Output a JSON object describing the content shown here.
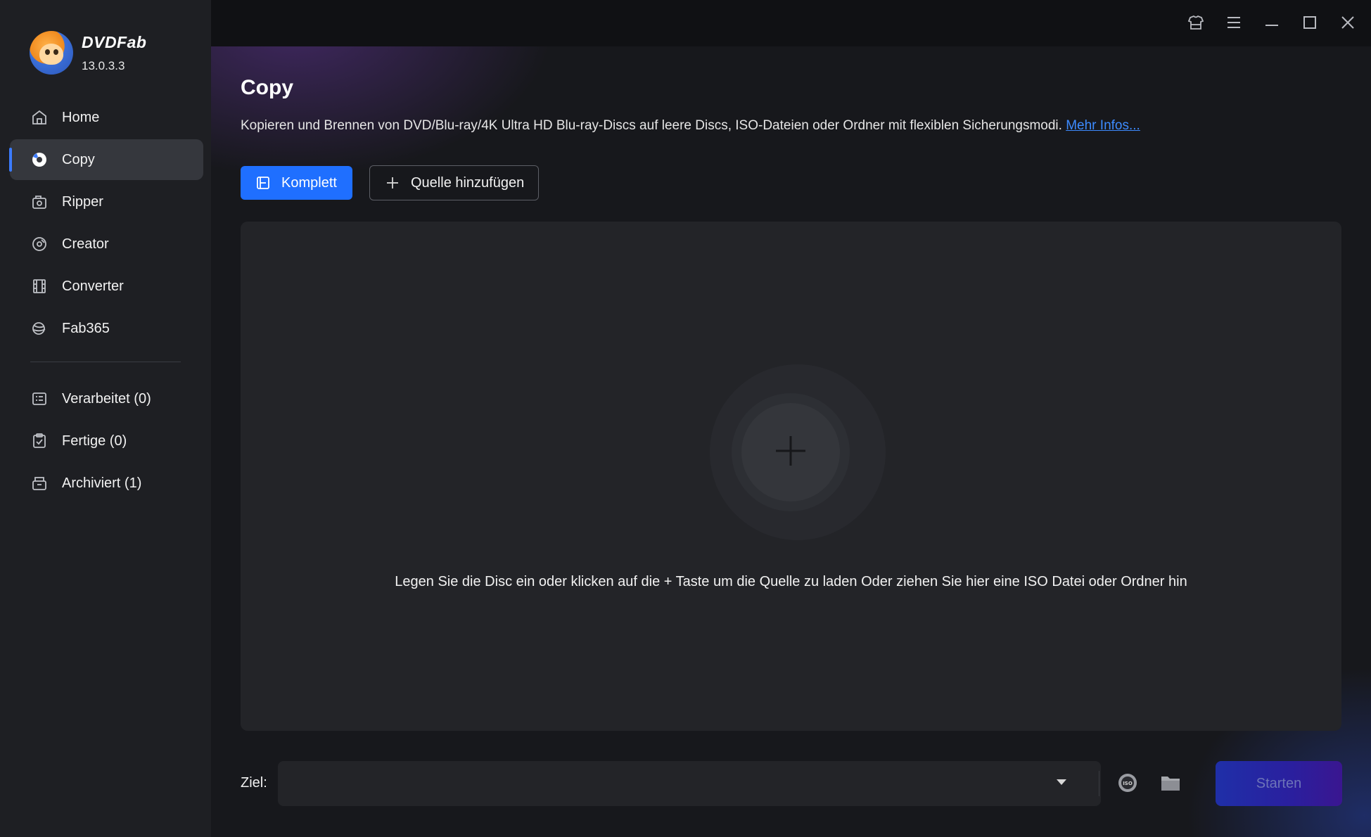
{
  "app": {
    "name": "DVDFab",
    "version": "13.0.3.3"
  },
  "sidebar": {
    "items": [
      {
        "label": "Home",
        "icon": "home-icon"
      },
      {
        "label": "Copy",
        "icon": "disc-icon",
        "active": true
      },
      {
        "label": "Ripper",
        "icon": "ripper-icon"
      },
      {
        "label": "Creator",
        "icon": "creator-icon"
      },
      {
        "label": "Converter",
        "icon": "film-icon"
      },
      {
        "label": "Fab365",
        "icon": "fab365-icon"
      }
    ],
    "queue": [
      {
        "label": "Verarbeitet (0)",
        "icon": "list-icon"
      },
      {
        "label": "Fertige (0)",
        "icon": "clipboard-check-icon"
      },
      {
        "label": "Archiviert (1)",
        "icon": "archive-icon"
      }
    ]
  },
  "main": {
    "title": "Copy",
    "description": "Kopieren und Brennen von DVD/Blu-ray/4K Ultra HD Blu-ray-Discs auf leere Discs, ISO-Dateien oder Ordner mit flexiblen Sicherungsmodi.",
    "more_link": "Mehr Infos...",
    "mode_button": "Komplett",
    "add_source_button": "Quelle hinzufügen",
    "dropzone_hint": "Legen Sie die Disc ein oder klicken auf die + Taste um die Quelle zu laden Oder ziehen Sie hier eine ISO Datei oder Ordner hin"
  },
  "footer": {
    "ziel_label": "Ziel:",
    "ziel_value": "",
    "start_button": "Starten"
  },
  "colors": {
    "accent": "#1f6fff",
    "sidebar_bg": "#1e1f23",
    "main_bg": "#17181c",
    "link": "#3d8bff"
  }
}
